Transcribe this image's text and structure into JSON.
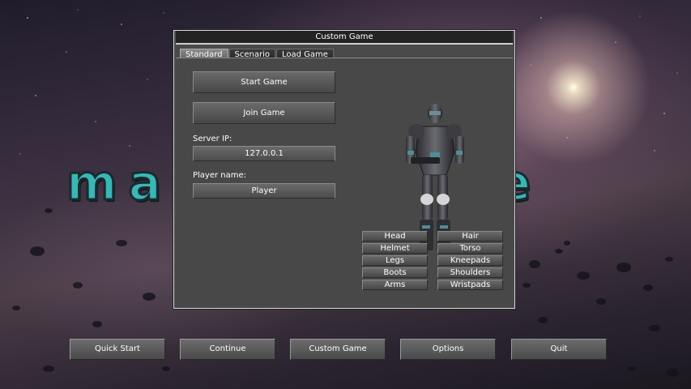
{
  "logo": {
    "text": "masterspace"
  },
  "dialog": {
    "title": "Custom Game",
    "tabs": [
      {
        "label": "Standard",
        "active": true
      },
      {
        "label": "Scenario",
        "active": false
      },
      {
        "label": "Load Game",
        "active": false
      }
    ],
    "start_game_label": "Start Game",
    "join_game_label": "Join Game",
    "server_ip_label": "Server IP:",
    "server_ip_value": "127.0.0.1",
    "player_name_label": "Player name:",
    "player_name_value": "Player",
    "character_parts": [
      [
        "Head",
        "Hair"
      ],
      [
        "Helmet",
        "Torso"
      ],
      [
        "Legs",
        "Kneepads"
      ],
      [
        "Boots",
        "Shoulders"
      ],
      [
        "Arms",
        "Wristpads"
      ]
    ]
  },
  "main_menu": {
    "quick_start": "Quick Start",
    "continue": "Continue",
    "custom_game": "Custom Game",
    "options": "Options",
    "quit": "Quit"
  },
  "colors": {
    "logo": "#39b7b6",
    "window_bg": "#484848",
    "button": "#5a5a5a"
  }
}
